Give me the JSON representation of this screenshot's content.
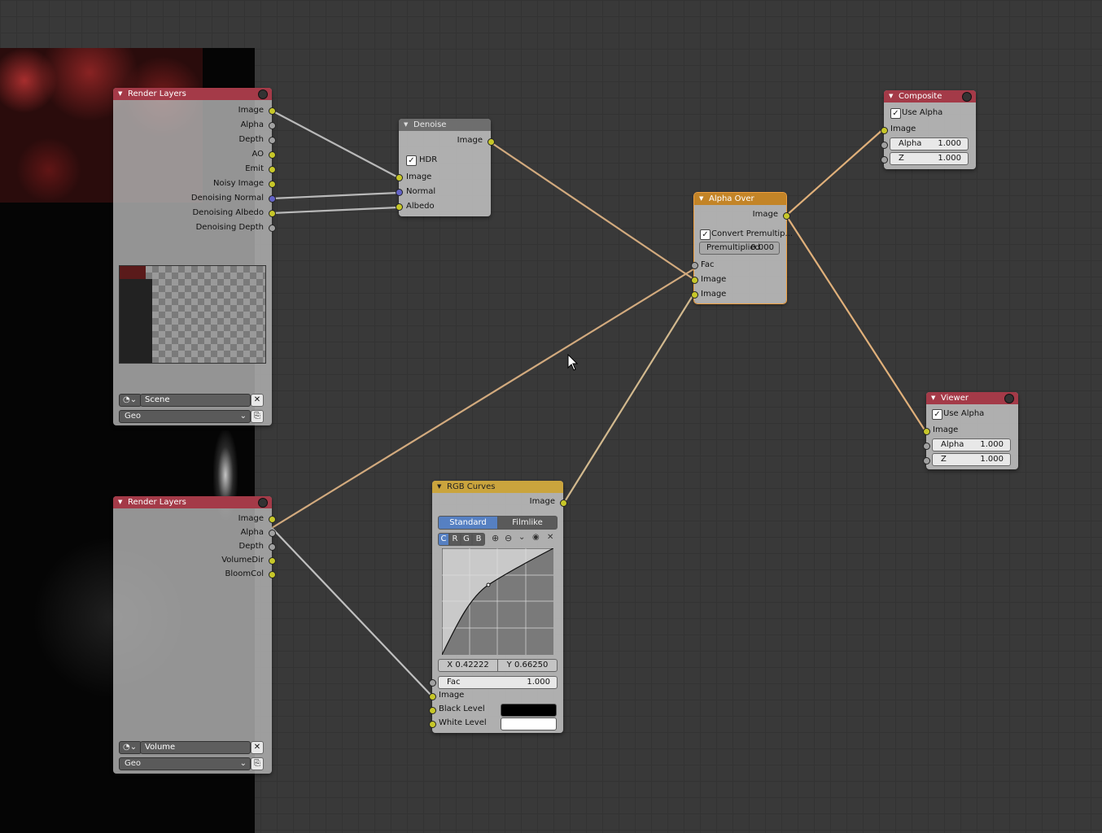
{
  "colors": {
    "socket_image": "#c7c729",
    "socket_value": "#a1a1a1",
    "socket_vector": "#6363c7",
    "header_input": "#a43a48",
    "header_output": "#a43a48",
    "header_color": "#c38427",
    "selected_outline": "#f0a040",
    "link_active": "#e6b070"
  },
  "render_layers_1": {
    "title": "Render Layers",
    "outputs": [
      "Image",
      "Alpha",
      "Depth",
      "AO",
      "Emit",
      "Noisy Image",
      "Denoising Normal",
      "Denoising Albedo",
      "Denoising Depth"
    ],
    "scene": "Scene",
    "layer": "Geo"
  },
  "render_layers_2": {
    "title": "Render Layers",
    "outputs": [
      "Image",
      "Alpha",
      "Depth",
      "VolumeDir",
      "BloomCol"
    ],
    "scene": "Volume",
    "layer": "Geo"
  },
  "denoise": {
    "title": "Denoise",
    "output": "Image",
    "hdr_label": "HDR",
    "inputs": [
      "Image",
      "Normal",
      "Albedo"
    ]
  },
  "alpha_over": {
    "title": "Alpha Over",
    "output": "Image",
    "convert_label": "Convert Premultip...",
    "premul_label": "Premultiplied",
    "premul_value": "0.000",
    "inputs": [
      "Fac",
      "Image",
      "Image"
    ]
  },
  "composite": {
    "title": "Composite",
    "use_alpha_label": "Use Alpha",
    "input": "Image",
    "alpha_label": "Alpha",
    "alpha_value": "1.000",
    "z_label": "Z",
    "z_value": "1.000"
  },
  "viewer": {
    "title": "Viewer",
    "use_alpha_label": "Use Alpha",
    "input": "Image",
    "alpha_label": "Alpha",
    "alpha_value": "1.000",
    "z_label": "Z",
    "z_value": "1.000"
  },
  "rgb_curves": {
    "title": "RGB Curves",
    "output": "Image",
    "tabs": [
      "Standard",
      "Filmlike"
    ],
    "channels": [
      "C",
      "R",
      "G",
      "B"
    ],
    "x_value": "X 0.42222",
    "y_value": "Y 0.66250",
    "fac_label": "Fac",
    "fac_value": "1.000",
    "image_label": "Image",
    "black_label": "Black Level",
    "white_label": "White Level"
  }
}
